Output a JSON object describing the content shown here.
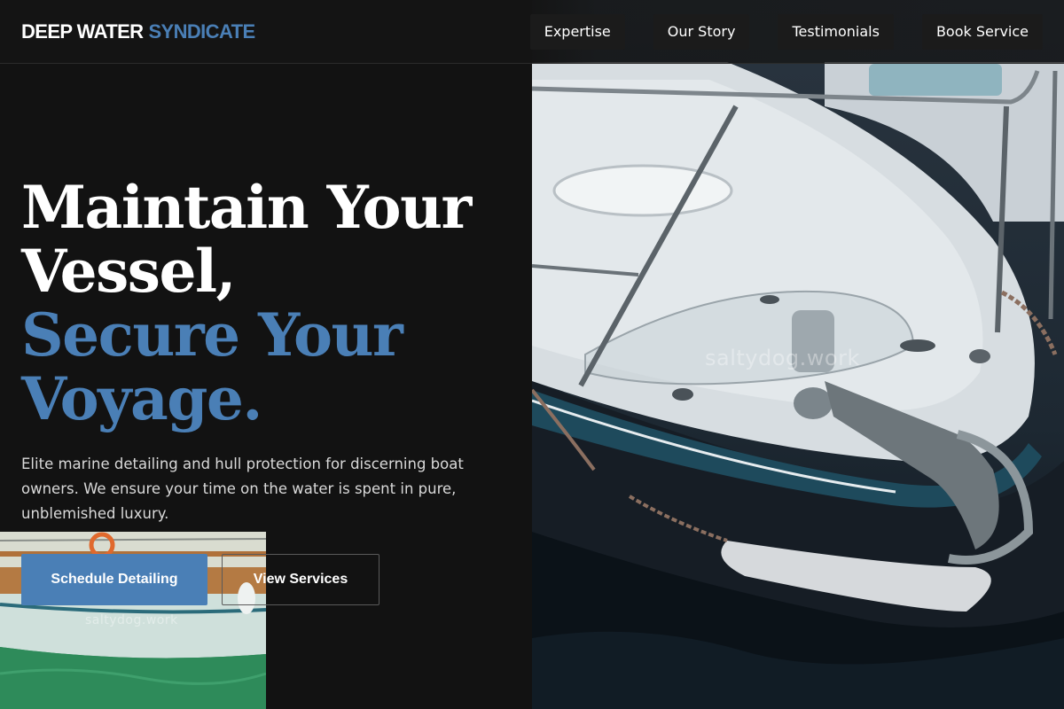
{
  "brand": {
    "part1": "DEEP WATER",
    "part2": "SYNDICATE"
  },
  "nav": {
    "items": [
      {
        "label": "Expertise"
      },
      {
        "label": "Our Story"
      },
      {
        "label": "Testimonials"
      },
      {
        "label": "Book Service"
      }
    ]
  },
  "hero": {
    "headline_white": [
      "Maintain Your",
      "Vessel,"
    ],
    "headline_blue": [
      "Secure Your",
      "Voyage."
    ],
    "subcopy": "Elite marine detailing and hull protection for discerning boat owners. We ensure your time on the water is spent in pure, unblemished luxury.",
    "primary_cta": "Schedule Detailing",
    "secondary_cta": "View Services",
    "photo_watermark": "saltydog.work",
    "inset_watermark": "saltydog.work"
  },
  "colors": {
    "accent": "#4a7fb6",
    "background": "#121212",
    "nav_button": "#1b1b1b"
  }
}
